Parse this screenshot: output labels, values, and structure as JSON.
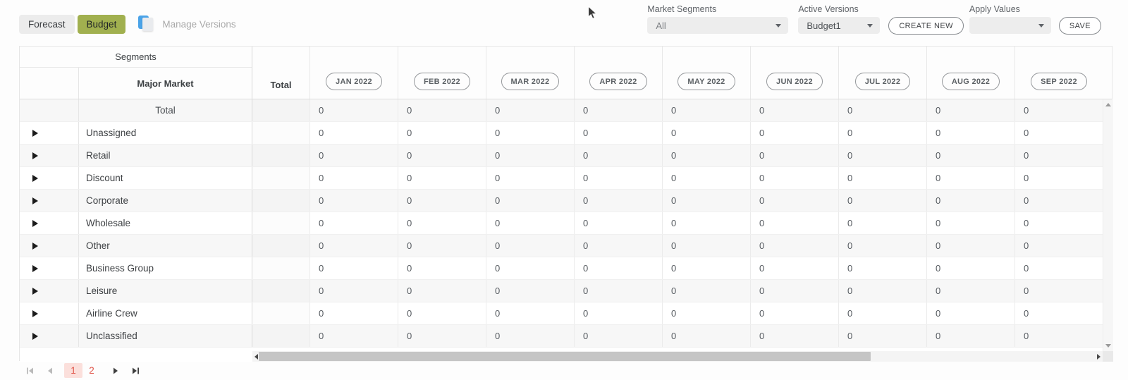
{
  "toolbar": {
    "forecast_label": "Forecast",
    "budget_label": "Budget",
    "manage_versions_label": "Manage Versions",
    "market_segments_label": "Market Segments",
    "market_segments_value": "All",
    "active_versions_label": "Active Versions",
    "active_versions_value": "Budget1",
    "create_new_label": "CREATE NEW",
    "apply_values_label": "Apply Values",
    "apply_values_value": "",
    "save_label": "SAVE"
  },
  "colors": {
    "budget_active_bg": "#a1b04f",
    "manage_versions_icon_blue": "#4aa3e8",
    "current_page_bg": "#fbdfdb",
    "current_page_text": "#e0564a"
  },
  "table": {
    "segments_header": "Segments",
    "major_market_header": "Major Market",
    "total_header": "Total",
    "months": [
      "JAN 2022",
      "FEB 2022",
      "MAR 2022",
      "APR 2022",
      "MAY 2022",
      "JUN 2022",
      "JUL 2022",
      "AUG 2022",
      "SEP 2022"
    ],
    "rows": [
      {
        "label": "Total",
        "expandable": false,
        "total_value": "",
        "values": [
          "0",
          "0",
          "0",
          "0",
          "0",
          "0",
          "0",
          "0",
          "0"
        ]
      },
      {
        "label": "Unassigned",
        "expandable": true,
        "total_value": "",
        "values": [
          "0",
          "0",
          "0",
          "0",
          "0",
          "0",
          "0",
          "0",
          "0"
        ]
      },
      {
        "label": "Retail",
        "expandable": true,
        "total_value": "",
        "values": [
          "0",
          "0",
          "0",
          "0",
          "0",
          "0",
          "0",
          "0",
          "0"
        ]
      },
      {
        "label": "Discount",
        "expandable": true,
        "total_value": "",
        "values": [
          "0",
          "0",
          "0",
          "0",
          "0",
          "0",
          "0",
          "0",
          "0"
        ]
      },
      {
        "label": "Corporate",
        "expandable": true,
        "total_value": "",
        "values": [
          "0",
          "0",
          "0",
          "0",
          "0",
          "0",
          "0",
          "0",
          "0"
        ]
      },
      {
        "label": "Wholesale",
        "expandable": true,
        "total_value": "",
        "values": [
          "0",
          "0",
          "0",
          "0",
          "0",
          "0",
          "0",
          "0",
          "0"
        ]
      },
      {
        "label": "Other",
        "expandable": true,
        "total_value": "",
        "values": [
          "0",
          "0",
          "0",
          "0",
          "0",
          "0",
          "0",
          "0",
          "0"
        ]
      },
      {
        "label": "Business Group",
        "expandable": true,
        "total_value": "",
        "values": [
          "0",
          "0",
          "0",
          "0",
          "0",
          "0",
          "0",
          "0",
          "0"
        ]
      },
      {
        "label": "Leisure",
        "expandable": true,
        "total_value": "",
        "values": [
          "0",
          "0",
          "0",
          "0",
          "0",
          "0",
          "0",
          "0",
          "0"
        ]
      },
      {
        "label": "Airline Crew",
        "expandable": true,
        "total_value": "",
        "values": [
          "0",
          "0",
          "0",
          "0",
          "0",
          "0",
          "0",
          "0",
          "0"
        ]
      },
      {
        "label": "Unclassified",
        "expandable": true,
        "total_value": "",
        "values": [
          "0",
          "0",
          "0",
          "0",
          "0",
          "0",
          "0",
          "0",
          "0"
        ]
      }
    ]
  },
  "pagination": {
    "pages": [
      "1",
      "2"
    ],
    "current_page": "1"
  }
}
